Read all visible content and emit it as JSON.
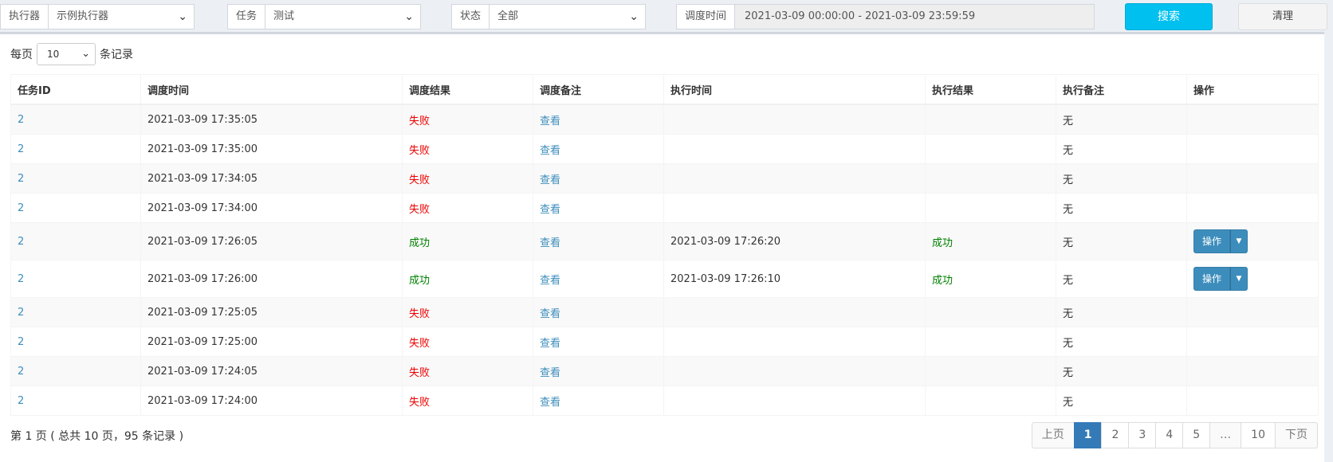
{
  "filters": {
    "executor_label": "执行器",
    "executor_value": "示例执行器",
    "task_label": "任务",
    "task_value": "测试",
    "status_label": "状态",
    "status_value": "全部",
    "time_label": "调度时间",
    "time_value": "2021-03-09 00:00:00 - 2021-03-09 23:59:59",
    "search_label": "搜索",
    "clear_label": "清理"
  },
  "page_size": {
    "prefix": "每页",
    "value": "10",
    "suffix": "条记录"
  },
  "table": {
    "headers": [
      "任务ID",
      "调度时间",
      "调度结果",
      "调度备注",
      "执行时间",
      "执行结果",
      "执行备注",
      "操作"
    ],
    "rows": [
      {
        "id": "2",
        "trigger_time": "2021-03-09 17:35:05",
        "trigger_result": "失败",
        "trigger_note": "查看",
        "exec_time": "",
        "exec_result": "",
        "exec_note": "无",
        "op": ""
      },
      {
        "id": "2",
        "trigger_time": "2021-03-09 17:35:00",
        "trigger_result": "失败",
        "trigger_note": "查看",
        "exec_time": "",
        "exec_result": "",
        "exec_note": "无",
        "op": ""
      },
      {
        "id": "2",
        "trigger_time": "2021-03-09 17:34:05",
        "trigger_result": "失败",
        "trigger_note": "查看",
        "exec_time": "",
        "exec_result": "",
        "exec_note": "无",
        "op": ""
      },
      {
        "id": "2",
        "trigger_time": "2021-03-09 17:34:00",
        "trigger_result": "失败",
        "trigger_note": "查看",
        "exec_time": "",
        "exec_result": "",
        "exec_note": "无",
        "op": ""
      },
      {
        "id": "2",
        "trigger_time": "2021-03-09 17:26:05",
        "trigger_result": "成功",
        "trigger_note": "查看",
        "exec_time": "2021-03-09 17:26:20",
        "exec_result": "成功",
        "exec_note": "无",
        "op": "操作"
      },
      {
        "id": "2",
        "trigger_time": "2021-03-09 17:26:00",
        "trigger_result": "成功",
        "trigger_note": "查看",
        "exec_time": "2021-03-09 17:26:10",
        "exec_result": "成功",
        "exec_note": "无",
        "op": "操作"
      },
      {
        "id": "2",
        "trigger_time": "2021-03-09 17:25:05",
        "trigger_result": "失败",
        "trigger_note": "查看",
        "exec_time": "",
        "exec_result": "",
        "exec_note": "无",
        "op": ""
      },
      {
        "id": "2",
        "trigger_time": "2021-03-09 17:25:00",
        "trigger_result": "失败",
        "trigger_note": "查看",
        "exec_time": "",
        "exec_result": "",
        "exec_note": "无",
        "op": ""
      },
      {
        "id": "2",
        "trigger_time": "2021-03-09 17:24:05",
        "trigger_result": "失败",
        "trigger_note": "查看",
        "exec_time": "",
        "exec_result": "",
        "exec_note": "无",
        "op": ""
      },
      {
        "id": "2",
        "trigger_time": "2021-03-09 17:24:00",
        "trigger_result": "失败",
        "trigger_note": "查看",
        "exec_time": "",
        "exec_result": "",
        "exec_note": "无",
        "op": ""
      }
    ]
  },
  "footer": {
    "info": "第 1 页 ( 总共 10 页，95 条记录 )"
  },
  "pagination": {
    "prev": "上页",
    "pages": [
      "1",
      "2",
      "3",
      "4",
      "5",
      "…",
      "10"
    ],
    "active": "1",
    "next": "下页"
  },
  "colors": {
    "fail": "#ee0000",
    "success": "#008000",
    "link": "#3c8dbc",
    "search_button": "#00c0ef",
    "primary": "#337ab7"
  },
  "icons": {
    "select_chevron": "chevron-down-icon",
    "dropdown_caret": "caret-down-icon"
  }
}
